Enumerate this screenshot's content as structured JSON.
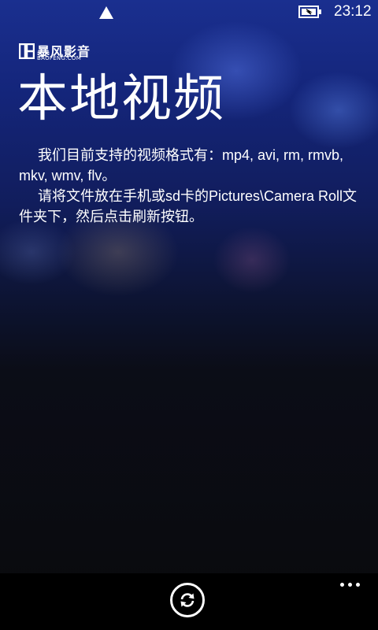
{
  "status_bar": {
    "time": "23:12",
    "signal_icon": "signal-triangle-icon",
    "battery_icon": "battery-charging-icon"
  },
  "app": {
    "logo_text": "暴风影音",
    "logo_subtext": "BAOFENG.COM"
  },
  "page": {
    "title": "本地视频",
    "paragraphs": [
      "我们目前支持的视频格式有：mp4, avi, rm, rmvb, mkv, wmv, flv。",
      "请将文件放在手机或sd卡的Pictures\\Camera Roll文件夹下，然后点击刷新按钮。"
    ]
  },
  "app_bar": {
    "refresh_icon": "refresh-icon",
    "more_icon": "more-dots-icon"
  },
  "colors": {
    "background_top": "#1a2f8f",
    "background_bottom": "#0a0a0c",
    "text": "#ffffff",
    "app_bar": "#000000"
  }
}
